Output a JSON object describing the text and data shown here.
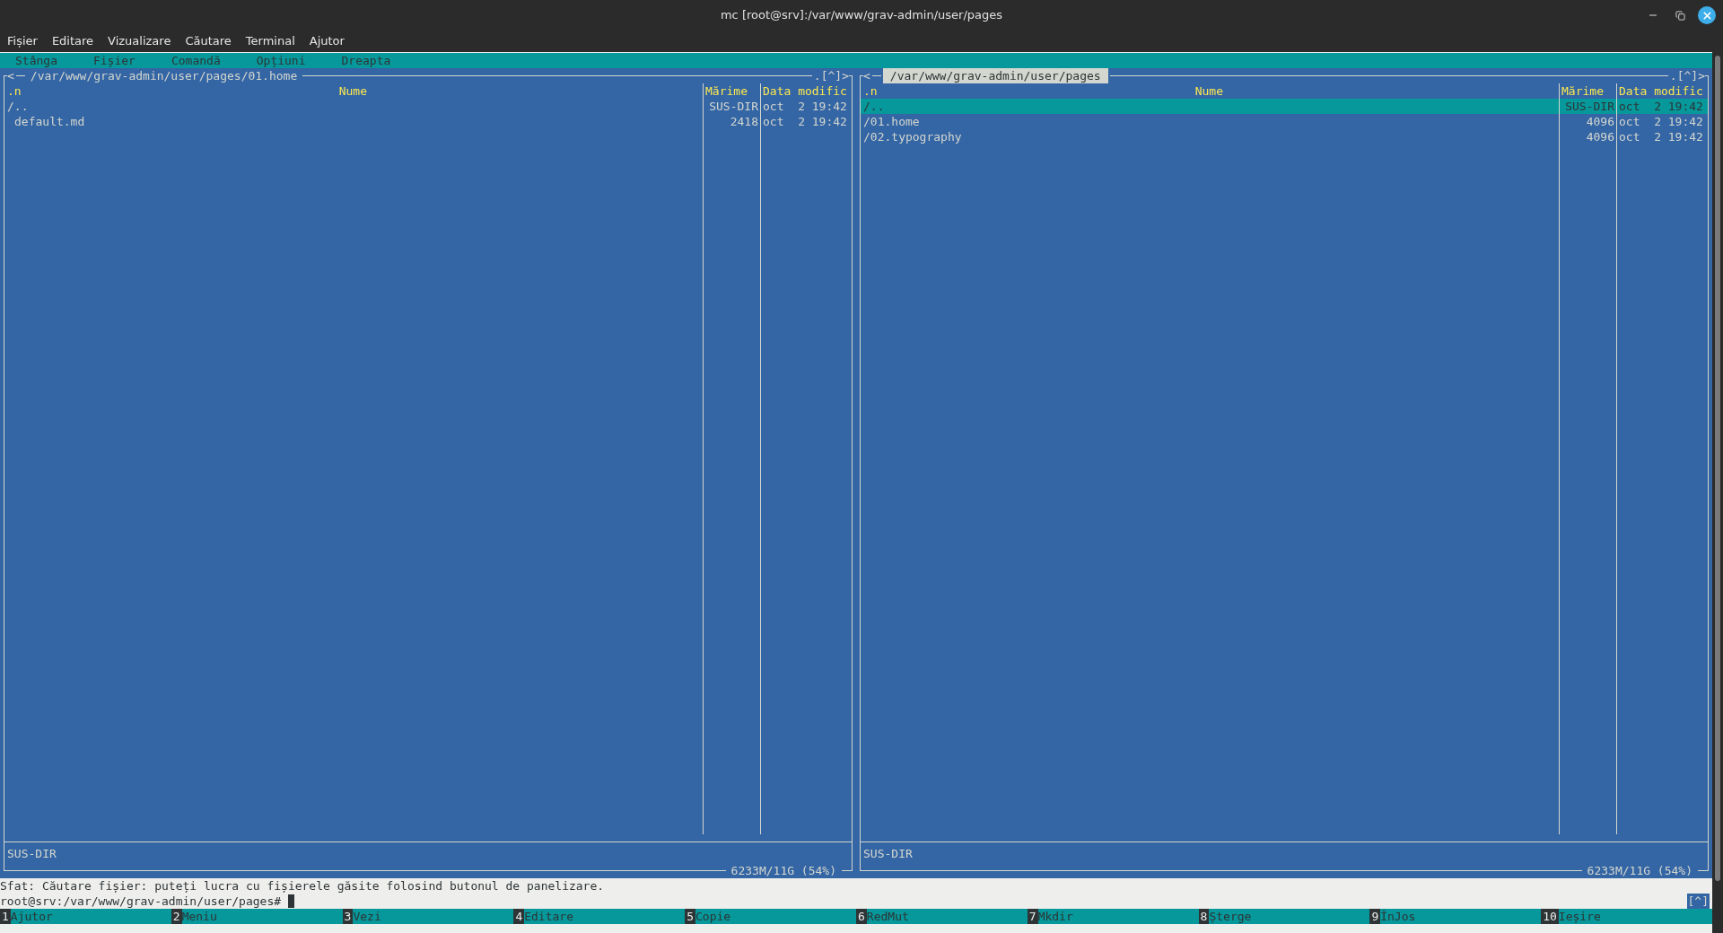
{
  "window": {
    "title": "mc [root@srv]:/var/www/grav-admin/user/pages"
  },
  "menu_bar": [
    "Fișier",
    "Editare",
    "Vizualizare",
    "Căutare",
    "Terminal",
    "Ajutor"
  ],
  "mc_menu": [
    "Stânga",
    "Fișier",
    "Comandă",
    "Opțiuni",
    "Dreapta"
  ],
  "panels": [
    {
      "active": false,
      "nav": "<",
      "path": "/var/www/grav-admin/user/pages/01.home",
      "history": ".[^]>",
      "sort": ".n",
      "columns": [
        "Nume",
        "Mărime",
        "Data modific"
      ],
      "rows": [
        {
          "kind": "dir",
          "name": "/..",
          "size": "SUS-DIR",
          "date": "oct  2 19:42",
          "selected": false
        },
        {
          "kind": "file",
          "name": "default.md",
          "size": "2418",
          "date": "oct  2 19:42",
          "selected": false
        }
      ],
      "mini_status": "SUS-DIR",
      "disk": "6233M/11G (54%)"
    },
    {
      "active": true,
      "nav": "<",
      "path": "/var/www/grav-admin/user/pages",
      "history": ".[^]>",
      "sort": ".n",
      "columns": [
        "Nume",
        "Mărime",
        "Data modific"
      ],
      "rows": [
        {
          "kind": "dir",
          "name": "/..",
          "size": "SUS-DIR",
          "date": "oct  2 19:42",
          "selected": true
        },
        {
          "kind": "dir",
          "name": "/01.home",
          "size": "4096",
          "date": "oct  2 19:42",
          "selected": false
        },
        {
          "kind": "dir",
          "name": "/02.typography",
          "size": "4096",
          "date": "oct  2 19:42",
          "selected": false
        }
      ],
      "mini_status": "SUS-DIR",
      "disk": "6233M/11G (54%)"
    }
  ],
  "hint": "Sfat: Căutare fișier: puteți lucra cu fișierele găsite folosind butonul de panelizare.",
  "prompt": "root@srv:/var/www/grav-admin/user/pages#",
  "history_button": "[^]",
  "function_keys": [
    {
      "key": "1",
      "label": "Ajutor"
    },
    {
      "key": "2",
      "label": "Meniu"
    },
    {
      "key": "3",
      "label": "Vezi"
    },
    {
      "key": "4",
      "label": "Editare"
    },
    {
      "key": "5",
      "label": "Copie"
    },
    {
      "key": "6",
      "label": "RedMut"
    },
    {
      "key": "7",
      "label": "Mkdir"
    },
    {
      "key": "8",
      "label": "Șterge"
    },
    {
      "key": "9",
      "label": "ÎnJos"
    },
    {
      "key": "10",
      "label": "Ieșire"
    }
  ]
}
